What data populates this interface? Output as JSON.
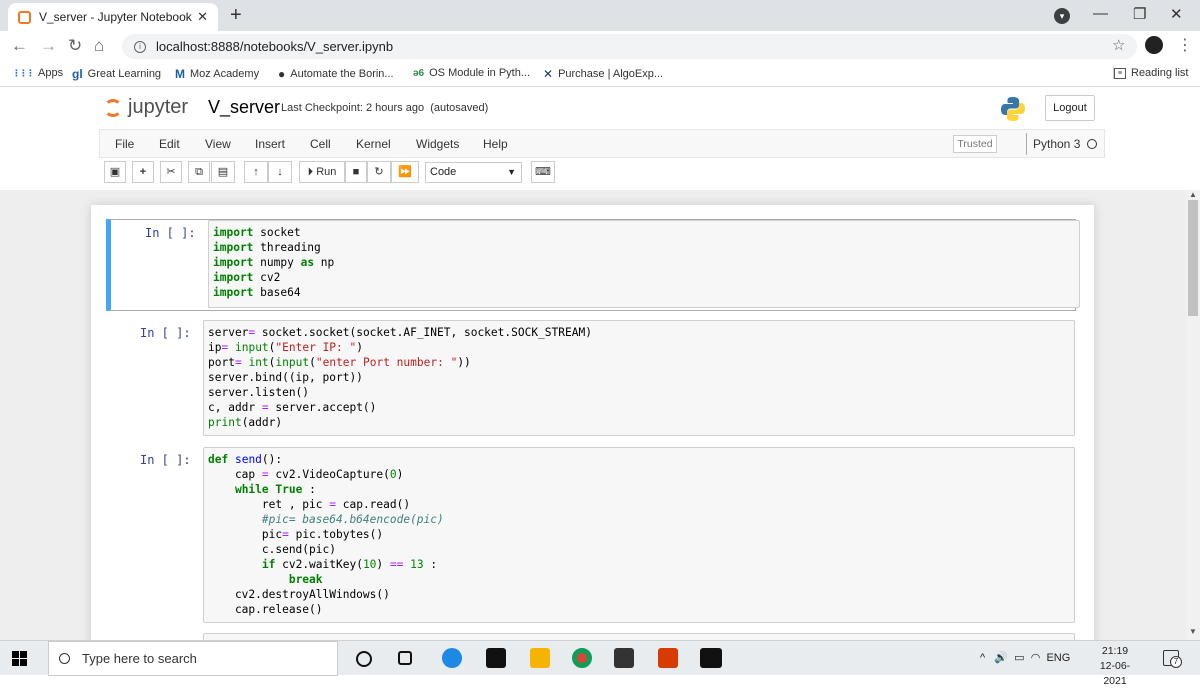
{
  "browser": {
    "tab_title": "V_server - Jupyter Notebook",
    "tab_close": "✕",
    "new_tab": "+",
    "url": "localhost:8888/notebooks/V_server.ipynb",
    "window_controls": [
      "—",
      "❐",
      "✕"
    ]
  },
  "bookmarks": [
    {
      "label": "Apps",
      "icon": "apps-grid-icon",
      "glyph": "⋮⋮⋮"
    },
    {
      "label": "Great Learning",
      "icon": "great-learning-icon",
      "glyph": "gl"
    },
    {
      "label": "Moz Academy",
      "icon": "moz-icon",
      "glyph": "M"
    },
    {
      "label": "Automate the Borin...",
      "icon": "automate-icon",
      "glyph": "●"
    },
    {
      "label": "OS Module in Pyth...",
      "icon": "geeks-icon",
      "glyph": "ə6"
    },
    {
      "label": "Purchase | AlgoExp...",
      "icon": "algoexpert-icon",
      "glyph": "✕"
    }
  ],
  "reading_list": "Reading list",
  "jupyter": {
    "logo_text": "jupyter",
    "notebook_name": "V_server",
    "checkpoint": "Last Checkpoint: 2 hours ago",
    "autosave": "(autosaved)",
    "logout": "Logout",
    "menus": [
      "File",
      "Edit",
      "View",
      "Insert",
      "Cell",
      "Kernel",
      "Widgets",
      "Help"
    ],
    "trusted": "Trusted",
    "kernel": "Python 3",
    "run_label": "Run",
    "cell_type": "Code",
    "accent": "#f37726"
  },
  "cells": [
    {
      "prompt": "In [ ]:",
      "selected": true
    },
    {
      "prompt": "In [ ]:",
      "selected": false
    },
    {
      "prompt": "In [ ]:",
      "selected": false
    }
  ],
  "taskbar": {
    "search_placeholder": "Type here to search",
    "language": "ENG",
    "time": "21:19",
    "date": "12-06-2021",
    "notification_count": "7"
  }
}
